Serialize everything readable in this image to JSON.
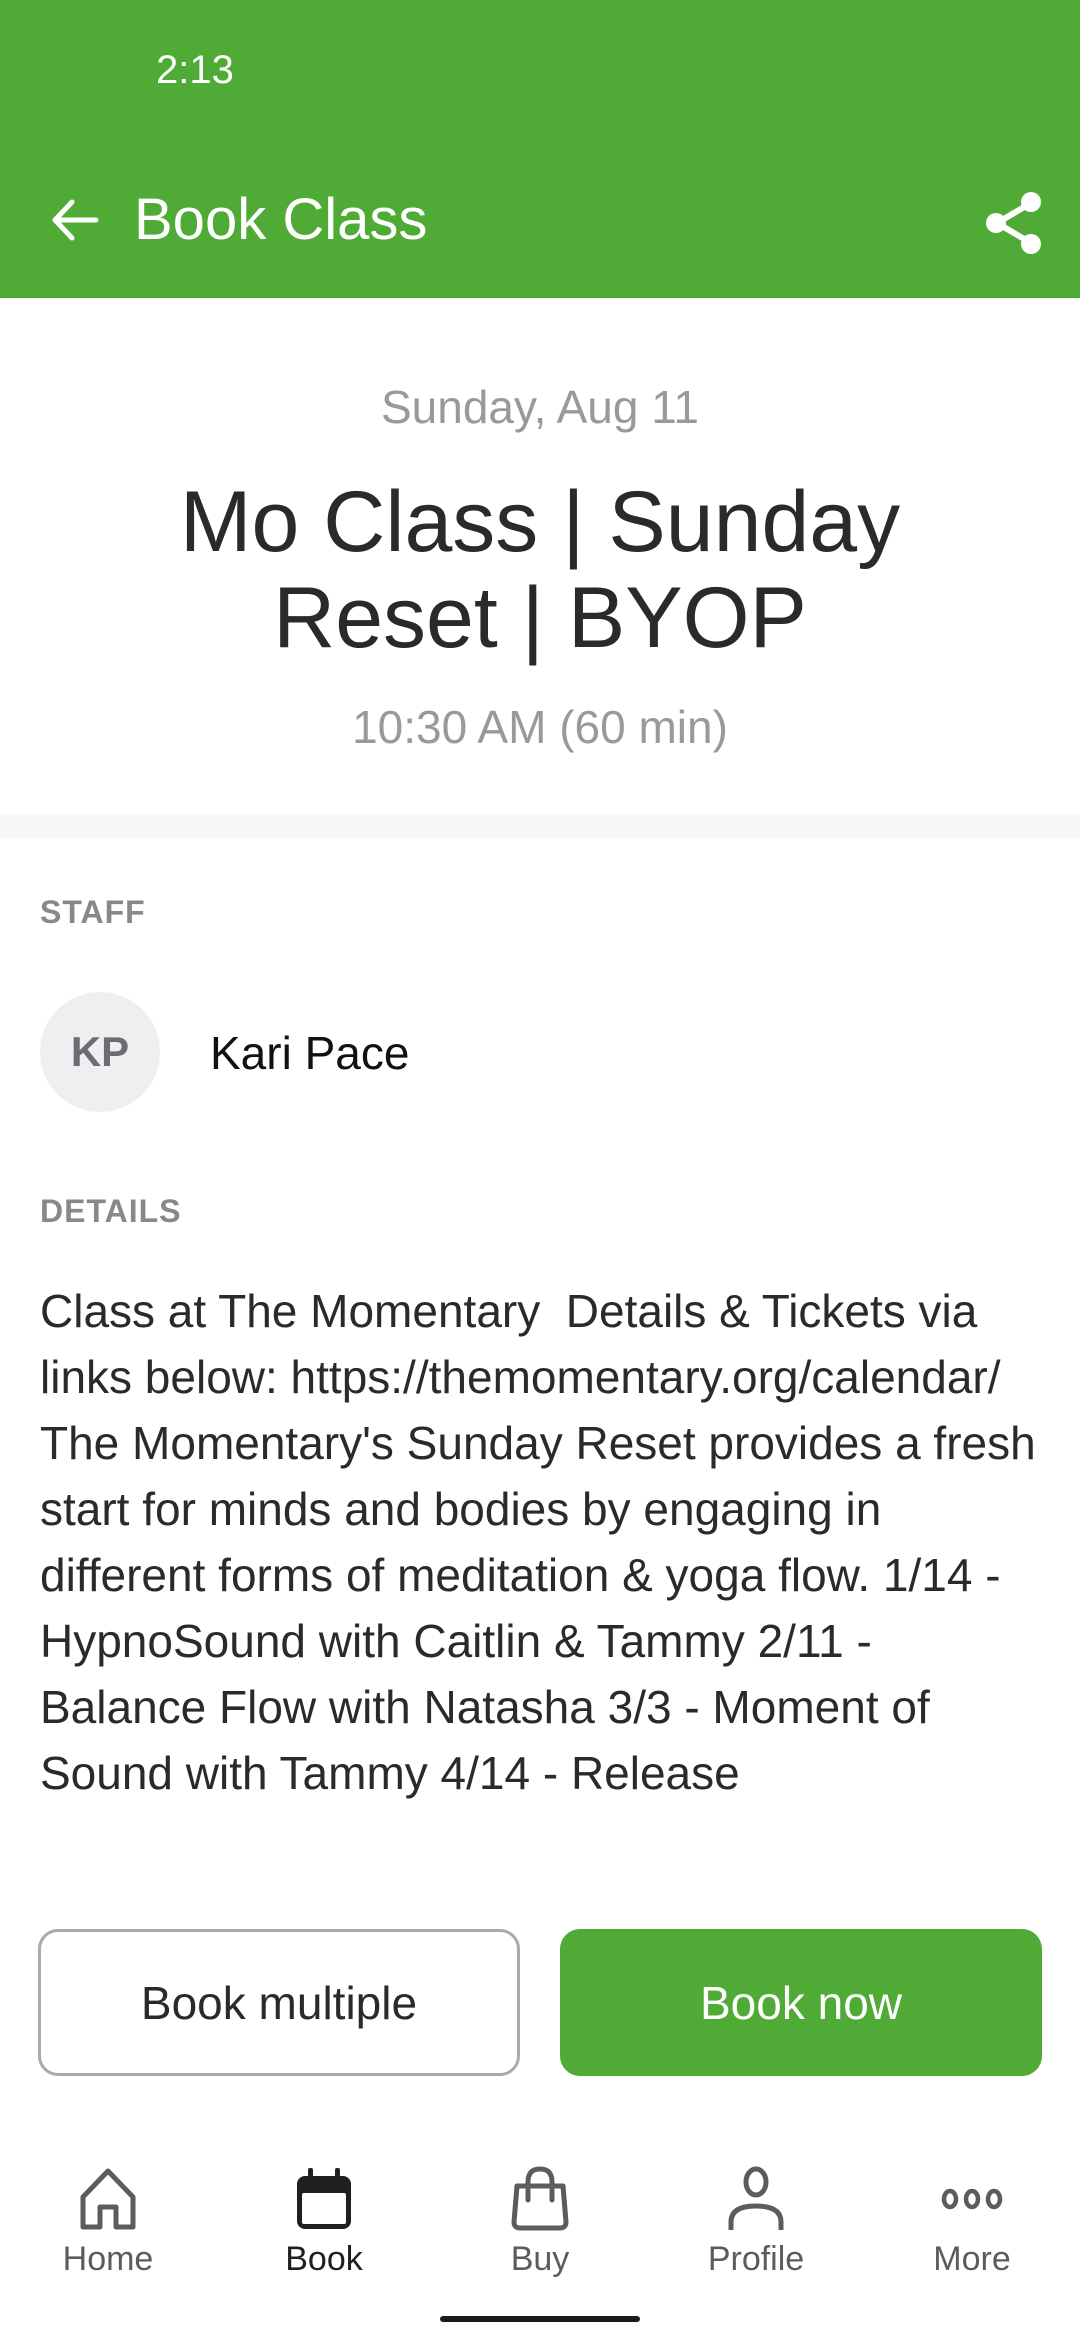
{
  "status_bar": {
    "time": "2:13"
  },
  "toolbar": {
    "title": "Book Class",
    "back_icon": "arrow-left-icon",
    "share_icon": "share-icon"
  },
  "class": {
    "date": "Sunday, Aug 11",
    "title": "Mo Class | Sunday Reset | BYOP",
    "time": "10:30 AM (60 min)"
  },
  "staff": {
    "section_label": "STAFF",
    "members": [
      {
        "initials": "KP",
        "name": "Kari Pace"
      }
    ]
  },
  "details": {
    "section_label": "DETAILS",
    "text": "Class at The Momentary  Details & Tickets via links below: https://themomentary.org/calendar/   The Momentary's Sunday Reset provides a fresh start for minds and bodies by engaging in different forms of meditation & yoga flow. 1/14 - HypnoSound with Caitlin & Tammy 2/11 - Balance Flow with Natasha 3/3 - Moment of Sound with Tammy 4/14 - Release"
  },
  "actions": {
    "book_multiple": "Book multiple",
    "book_now": "Book now"
  },
  "bottom_nav": {
    "items": [
      {
        "label": "Home",
        "icon": "home-icon",
        "active": false
      },
      {
        "label": "Book",
        "icon": "calendar-icon",
        "active": true
      },
      {
        "label": "Buy",
        "icon": "shopping-bag-icon",
        "active": false
      },
      {
        "label": "Profile",
        "icon": "person-icon",
        "active": false
      },
      {
        "label": "More",
        "icon": "more-dots-icon",
        "active": false
      }
    ]
  },
  "colors": {
    "brand_green": "#4fab36",
    "muted_text": "#999999",
    "section_label": "#888888"
  }
}
